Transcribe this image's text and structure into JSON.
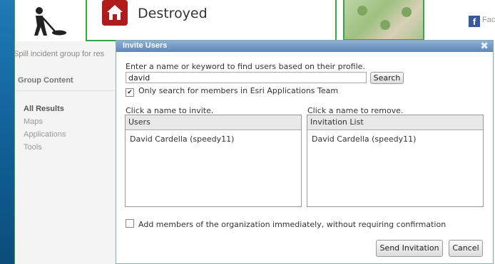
{
  "background_page": {
    "group_description": "Spill incident group for res",
    "group_content_heading": "Group Content",
    "nav": [
      {
        "label": "All Results",
        "active": true
      },
      {
        "label": "Maps",
        "active": false
      },
      {
        "label": "Applications",
        "active": false
      },
      {
        "label": "Tools",
        "active": false
      }
    ],
    "facebook_text": "Fac",
    "facebook_icon_glyph": "f"
  },
  "card": {
    "label": "Destroyed",
    "icon": "house-damage-icon",
    "icon_color": "#b01c1c"
  },
  "dialog": {
    "title": "Invite Users",
    "instruction": "Enter a name or keyword to find users based on their profile.",
    "search": {
      "value": "david",
      "button_label": "Search"
    },
    "only_members_checkbox": {
      "checked": true,
      "label": "Only search for members in Esri Applications Team"
    },
    "users_panel": {
      "caption": "Click a name to invite.",
      "header": "Users",
      "items": [
        "David Cardella (speedy11)"
      ]
    },
    "invitation_panel": {
      "caption": "Click a name to remove.",
      "header": "Invitation List",
      "items": [
        "David Cardella (speedy11)"
      ]
    },
    "add_members_checkbox": {
      "checked": false,
      "label": "Add members of the organization immediately, without requiring confirmation"
    },
    "send_label": "Send Invitation",
    "cancel_label": "Cancel"
  },
  "colors": {
    "accent_green": "#3aa34a",
    "title_bar": "#5d86b8",
    "facebook_blue": "#3b5998"
  }
}
